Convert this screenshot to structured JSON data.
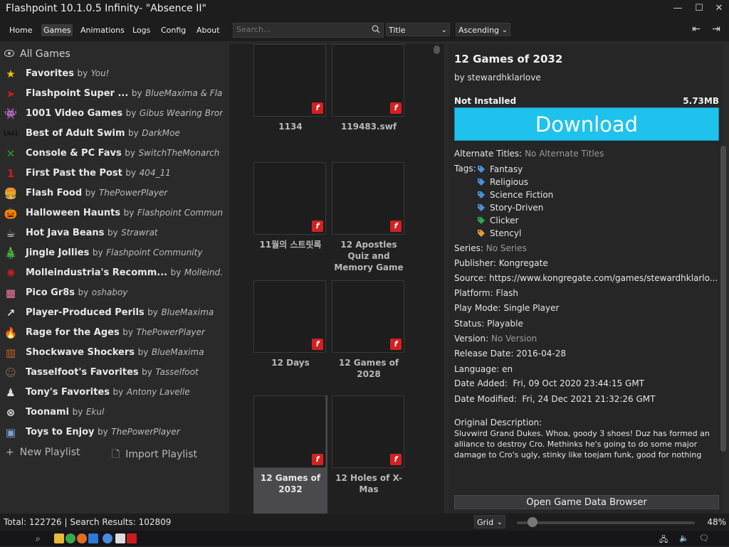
{
  "window": {
    "title": "Flashpoint 10.1.0.5 Infinity- \"Absence II\""
  },
  "menu": [
    "Home",
    "Games",
    "Animations",
    "Logs",
    "Config",
    "About"
  ],
  "search": {
    "placeholder": "Search..."
  },
  "sort": {
    "field": "Title",
    "order": "Ascending"
  },
  "sidebar": {
    "all_games": "All Games",
    "by_word": "by",
    "playlists": [
      {
        "name": "Favorites",
        "author": "You!",
        "icon": "star-icon",
        "color": "#f2c200"
      },
      {
        "name": "Flashpoint Super ...",
        "author": "BlueMaxima & Fla...",
        "icon": "flashpoint-logo-icon",
        "color": "#c81e1e"
      },
      {
        "name": "1001 Video Games",
        "author": "Gibus Wearing Brony",
        "icon": "space-invader-icon",
        "color": "#3a3a3a"
      },
      {
        "name": "Best of Adult Swim",
        "author": "DarkMoe",
        "icon": "adult-swim-icon",
        "color": "#111111"
      },
      {
        "name": "Console & PC Favs",
        "author": "SwitchTheMonarch",
        "icon": "xbox-icon",
        "color": "#2f9e2f"
      },
      {
        "name": "First Past the Post",
        "author": "404_11",
        "icon": "number-one-icon",
        "color": "#c81e1e"
      },
      {
        "name": "Flash Food",
        "author": "ThePowerPlayer",
        "icon": "burger-icon",
        "color": "#d88a2a"
      },
      {
        "name": "Halloween Haunts",
        "author": "Flashpoint Community",
        "icon": "pumpkin-icon",
        "color": "#e86a10"
      },
      {
        "name": "Hot Java Beans",
        "author": "Strawrat",
        "icon": "coffee-cup-icon",
        "color": "#dddddd"
      },
      {
        "name": "Jingle Jollies",
        "author": "Flashpoint Community",
        "icon": "christmas-tree-icon",
        "color": "#2f9e2f"
      },
      {
        "name": "Molleindustria's Recomm...",
        "author": "Molleind...",
        "icon": "molleindustria-icon",
        "color": "#c81e1e"
      },
      {
        "name": "Pico Gr8s",
        "author": "oshaboy",
        "icon": "pico-8-icon",
        "color": "#ff77a8"
      },
      {
        "name": "Player-Produced Perils",
        "author": "BlueMaxima",
        "icon": "share-icon",
        "color": "#dddddd"
      },
      {
        "name": "Rage for the Ages",
        "author": "ThePowerPlayer",
        "icon": "flame-icon",
        "color": "#e8501a"
      },
      {
        "name": "Shockwave Shockers",
        "author": "BlueMaxima",
        "icon": "shockwave-icon",
        "color": "#c8641e"
      },
      {
        "name": "Tasselfoot's Favorites",
        "author": "Tasselfoot",
        "icon": "character-icon",
        "color": "#8a6a4a"
      },
      {
        "name": "Tony's Favorites",
        "author": "Antony Lavelle",
        "icon": "silhouette-icon",
        "color": "#dddddd"
      },
      {
        "name": "Toonami",
        "author": "Ekul",
        "icon": "toonami-icon",
        "color": "#dddddd"
      },
      {
        "name": "Toys to Enjoy",
        "author": "ThePowerPlayer",
        "icon": "toy-blocks-icon",
        "color": "#7aa0d0"
      }
    ],
    "new_playlist": "New Playlist",
    "import_playlist": "Import Playlist"
  },
  "games": [
    {
      "title": "1134"
    },
    {
      "title": "119483.swf"
    },
    {
      "title": "11월의 스트릿록"
    },
    {
      "title": "12 Apostles Quiz and Memory Game"
    },
    {
      "title": "12 Days"
    },
    {
      "title": "12 Games of 2028"
    },
    {
      "title": "12 Games of 2032",
      "selected": true
    },
    {
      "title": "12 Holes of X-Mas"
    }
  ],
  "details": {
    "title": "12 Games of 2032",
    "developer": "by stewardhklarlove",
    "install_status": "Not Installed",
    "size": "5.73MB",
    "download_label": "Download",
    "alternate_titles_label": "Alternate Titles:",
    "alternate_titles": "No Alternate Titles",
    "tags_label": "Tags:",
    "tags": [
      {
        "name": "Fantasy",
        "color": "#4a90d9"
      },
      {
        "name": "Religious",
        "color": "#4a90d9"
      },
      {
        "name": "Science Fiction",
        "color": "#4a90d9"
      },
      {
        "name": "Story-Driven",
        "color": "#4a90d9"
      },
      {
        "name": "Clicker",
        "color": "#2fa84f"
      },
      {
        "name": "Stencyl",
        "color": "#e09a3a"
      }
    ],
    "series_label": "Series:",
    "series": "No Series",
    "publisher_label": "Publisher:",
    "publisher": "Kongregate",
    "source_label": "Source:",
    "source": "https://www.kongregate.com/games/stewardhklarlo...",
    "platform_label": "Platform:",
    "platform": "Flash",
    "play_mode_label": "Play Mode:",
    "play_mode": "Single Player",
    "status_label": "Status:",
    "status": "Playable",
    "version_label": "Version:",
    "version": "No Version",
    "release_date_label": "Release Date:",
    "release_date": "2016-04-28",
    "language_label": "Language:",
    "language": "en",
    "date_added_label": "Date Added:",
    "date_added": "Fri, 09 Oct 2020 23:44:15 GMT",
    "date_modified_label": "Date Modified:",
    "date_modified": "Fri, 24 Dec 2021 21:32:26 GMT",
    "description_label": "Original Description:",
    "description": "Sluvwird Grand Dukes. Whoa, goody 3 shoes! Duz has formed an alliance to destroy Cro. Methinks he's going to do some major damage to Cro's ugly, stinky like toejam funk, good for nothing",
    "open_browser_label": "Open Game Data Browser"
  },
  "status_bar": {
    "text": "Total: 122726 | Search Results: 102809",
    "layout": "Grid",
    "zoom_percent": 48,
    "zoom_text": "48%"
  }
}
